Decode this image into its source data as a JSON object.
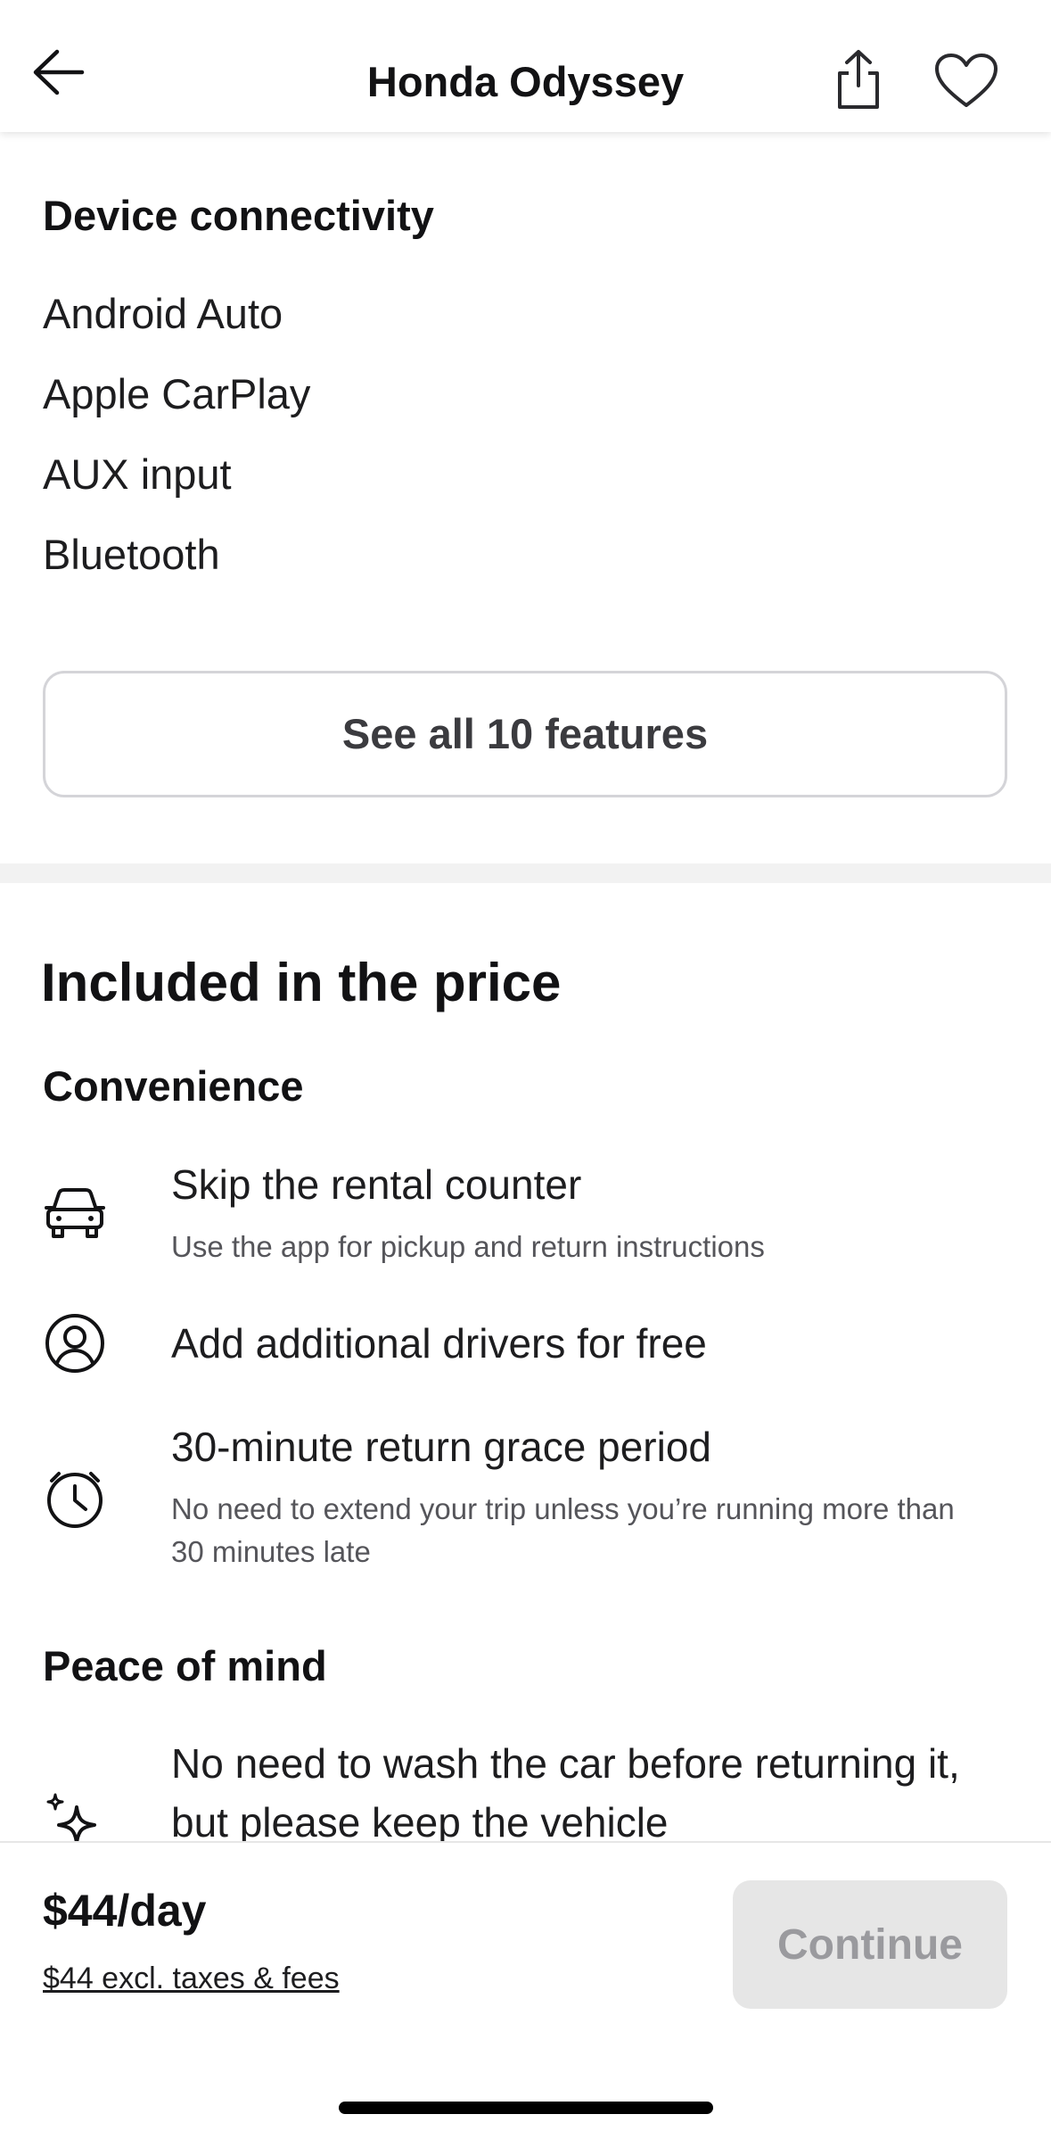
{
  "header": {
    "title": "Honda Odyssey",
    "icons": {
      "back": "arrow-left-icon",
      "share": "share-icon",
      "favorite": "heart-icon"
    }
  },
  "features": {
    "heading": "Device connectivity",
    "items": [
      "Android Auto",
      "Apple CarPlay",
      "AUX input",
      "Bluetooth"
    ],
    "see_all_label": "See all 10 features"
  },
  "included": {
    "heading": "Included in the price",
    "convenience": {
      "heading": "Convenience",
      "items": [
        {
          "icon": "car-icon",
          "title": "Skip the rental counter",
          "desc": "Use the app for pickup and return instructions"
        },
        {
          "icon": "user-circle-icon",
          "title": "Add additional drivers for free",
          "desc": ""
        },
        {
          "icon": "clock-icon",
          "title": "30-minute return grace period",
          "desc": "No need to extend your trip unless you’re running more than 30 minutes late"
        }
      ]
    },
    "peace_of_mind": {
      "heading": "Peace of mind",
      "items": [
        {
          "icon": "sparkles-icon",
          "title": "No need to wash the car before returning it, but please keep the vehicle"
        }
      ]
    }
  },
  "footer": {
    "price": "$44/day",
    "price_sub": "$44 excl. taxes & fees",
    "continue_label": "Continue"
  }
}
